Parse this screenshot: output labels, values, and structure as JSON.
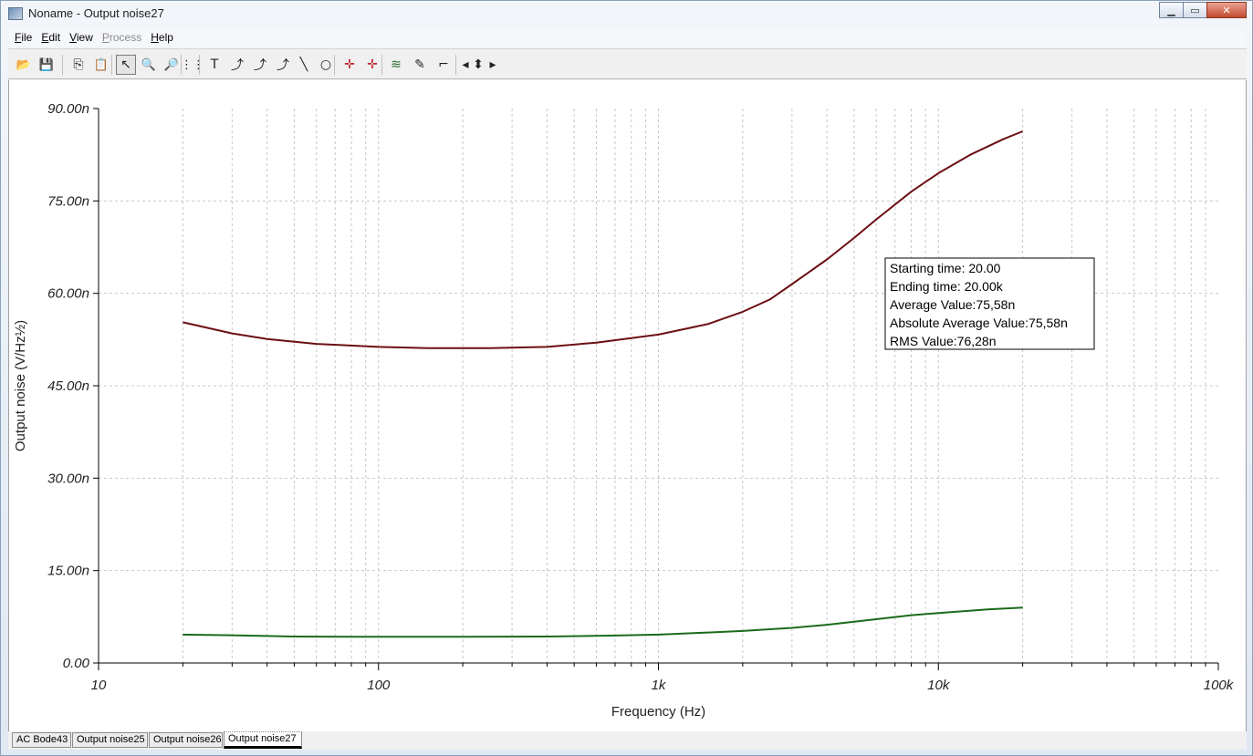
{
  "window": {
    "title": "Noname - Output noise27"
  },
  "menu": [
    {
      "label": "File",
      "accel": "F",
      "rest": "ile",
      "disabled": false
    },
    {
      "label": "Edit",
      "accel": "E",
      "rest": "dit",
      "disabled": false
    },
    {
      "label": "View",
      "accel": "V",
      "rest": "iew",
      "disabled": false
    },
    {
      "label": "Process",
      "accel": "P",
      "rest": "rocess",
      "disabled": true
    },
    {
      "label": "Help",
      "accel": "H",
      "rest": "elp",
      "disabled": false
    }
  ],
  "toolbar": [
    {
      "name": "open-folder-icon",
      "glyph": "📂"
    },
    {
      "name": "save-icon",
      "glyph": "💾"
    },
    {
      "name": "copy-icon",
      "glyph": "⎘"
    },
    {
      "name": "paste-icon",
      "glyph": "📋"
    },
    {
      "name": "pointer-icon",
      "glyph": "↖"
    },
    {
      "name": "zoom-in-icon",
      "glyph": "🔍"
    },
    {
      "name": "zoom-out-icon",
      "glyph": "🔎"
    },
    {
      "name": "grid-icon",
      "glyph": "⋮⋮"
    },
    {
      "name": "text-icon",
      "glyph": "T"
    },
    {
      "name": "curve-label-icon",
      "glyph": "⤴"
    },
    {
      "name": "curve-label2-icon",
      "glyph": "⤴"
    },
    {
      "name": "curve-label3-icon",
      "glyph": "⤴"
    },
    {
      "name": "line-icon",
      "glyph": "╲"
    },
    {
      "name": "circle-icon",
      "glyph": "○"
    },
    {
      "name": "cursor-a-icon",
      "glyph": "✛"
    },
    {
      "name": "cursor-b-icon",
      "glyph": "✛"
    },
    {
      "name": "add-curves-icon",
      "glyph": "≋"
    },
    {
      "name": "pen-icon",
      "glyph": "✎"
    },
    {
      "name": "step-icon",
      "glyph": "⌐"
    },
    {
      "name": "arrow-left-icon",
      "glyph": "◂"
    },
    {
      "name": "arrow-updown-icon",
      "glyph": "⬍"
    },
    {
      "name": "arrow-right-icon",
      "glyph": "▸"
    }
  ],
  "tabs": [
    "AC Bode43",
    "Output noise25",
    "Output noise26",
    "Output noise27"
  ],
  "active_tab": "Output noise27",
  "info_box": {
    "lines": [
      "Starting time: 20.00",
      "Ending time: 20.00k",
      "Average Value:75,58n",
      "Absolute Average Value:75,58n",
      "RMS Value:76,28n"
    ]
  },
  "chart_data": {
    "type": "line",
    "xlabel": "Frequency (Hz)",
    "ylabel": "Output noise (V/Hz½)",
    "xscale": "log",
    "xlim": [
      10,
      100000
    ],
    "ylim": [
      0,
      90
    ],
    "x_ticks": [
      {
        "value": 10,
        "label": "10"
      },
      {
        "value": 100,
        "label": "100"
      },
      {
        "value": 1000,
        "label": "1k"
      },
      {
        "value": 10000,
        "label": "10k"
      },
      {
        "value": 100000,
        "label": "100k"
      }
    ],
    "y_ticks": [
      {
        "value": 0,
        "label": "0.00"
      },
      {
        "value": 15,
        "label": "15.00n"
      },
      {
        "value": 30,
        "label": "30.00n"
      },
      {
        "value": 45,
        "label": "45.00n"
      },
      {
        "value": 60,
        "label": "60.00n"
      },
      {
        "value": 75,
        "label": "75.00n"
      },
      {
        "value": 90,
        "label": "90.00n"
      }
    ],
    "grid": true,
    "series": [
      {
        "color": "#6b0f14",
        "points": [
          [
            20,
            55.3
          ],
          [
            30,
            53.5
          ],
          [
            40,
            52.6
          ],
          [
            60,
            51.8
          ],
          [
            100,
            51.3
          ],
          [
            150,
            51.1
          ],
          [
            250,
            51.1
          ],
          [
            400,
            51.3
          ],
          [
            600,
            52.0
          ],
          [
            1000,
            53.3
          ],
          [
            1500,
            55.0
          ],
          [
            2000,
            57.0
          ],
          [
            2500,
            59.0
          ],
          [
            3000,
            61.5
          ],
          [
            4000,
            65.5
          ],
          [
            5000,
            69.0
          ],
          [
            6000,
            72.0
          ],
          [
            8000,
            76.5
          ],
          [
            10000,
            79.5
          ],
          [
            13000,
            82.5
          ],
          [
            17000,
            85.0
          ],
          [
            20000,
            86.3
          ]
        ]
      },
      {
        "color": "#1a6b1a",
        "points": [
          [
            20,
            4.6
          ],
          [
            30,
            4.5
          ],
          [
            50,
            4.3
          ],
          [
            100,
            4.25
          ],
          [
            200,
            4.25
          ],
          [
            400,
            4.3
          ],
          [
            700,
            4.45
          ],
          [
            1000,
            4.6
          ],
          [
            1500,
            4.95
          ],
          [
            2000,
            5.2
          ],
          [
            3000,
            5.7
          ],
          [
            4000,
            6.2
          ],
          [
            5000,
            6.7
          ],
          [
            6000,
            7.1
          ],
          [
            8000,
            7.75
          ],
          [
            10000,
            8.1
          ],
          [
            15000,
            8.7
          ],
          [
            20000,
            9.0
          ]
        ]
      }
    ]
  }
}
